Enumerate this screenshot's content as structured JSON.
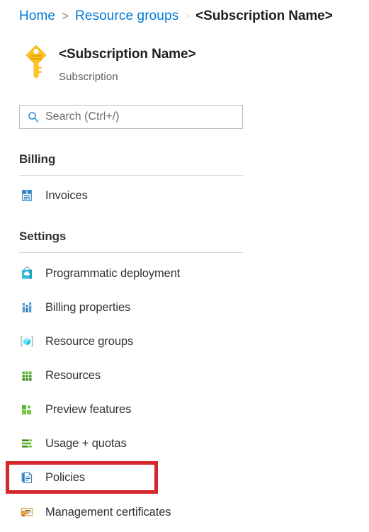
{
  "breadcrumb": {
    "items": [
      {
        "label": "Home",
        "type": "link"
      },
      {
        "label": "Resource groups",
        "type": "link"
      },
      {
        "label": "<Subscription Name>",
        "type": "current"
      }
    ],
    "separator": ">"
  },
  "header": {
    "icon": "key-icon",
    "title": "<Subscription Name>",
    "subtitle": "Subscription"
  },
  "search": {
    "placeholder": "Search (Ctrl+/)",
    "value": "",
    "icon": "search-icon"
  },
  "sections": [
    {
      "title": "Billing",
      "items": [
        {
          "label": "Invoices",
          "icon": "invoice-icon"
        }
      ]
    },
    {
      "title": "Settings",
      "items": [
        {
          "label": "Programmatic deployment",
          "icon": "shopping-bag-cloud-icon"
        },
        {
          "label": "Billing properties",
          "icon": "bar-chart-icon"
        },
        {
          "label": "Resource groups",
          "icon": "resource-group-cube-icon"
        },
        {
          "label": "Resources",
          "icon": "grid-icon"
        },
        {
          "label": "Preview features",
          "icon": "preview-sparkle-icon"
        },
        {
          "label": "Usage + quotas",
          "icon": "usage-bars-icon"
        },
        {
          "label": "Policies",
          "icon": "policy-documents-icon"
        },
        {
          "label": "Management certificates",
          "icon": "certificate-icon"
        }
      ]
    }
  ],
  "annotation": {
    "target": "Policies",
    "color": "#d6272c"
  }
}
